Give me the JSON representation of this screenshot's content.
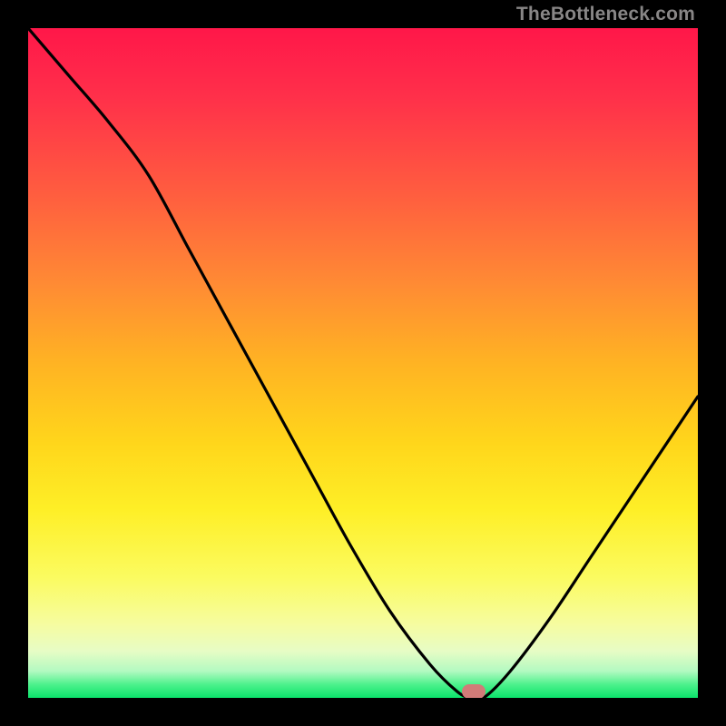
{
  "watermark": {
    "text": "TheBottleneck.com"
  },
  "marker": {
    "x_pct": 66.5,
    "y_pct": 99.0,
    "color": "#d17b78"
  },
  "chart_data": {
    "type": "line",
    "title": "",
    "xlabel": "",
    "ylabel": "",
    "xlim": [
      0,
      100
    ],
    "ylim": [
      0,
      100
    ],
    "grid": false,
    "legend": false,
    "background": "red-yellow-green vertical gradient",
    "series": [
      {
        "name": "bottleneck-curve",
        "x": [
          0,
          6,
          12,
          18,
          24,
          30,
          36,
          42,
          48,
          54,
          60,
          64,
          66,
          68,
          72,
          78,
          84,
          90,
          96,
          100
        ],
        "y": [
          100,
          93,
          86,
          78,
          67,
          56,
          45,
          34,
          23,
          13,
          5,
          1,
          0,
          0,
          4,
          12,
          21,
          30,
          39,
          45
        ]
      }
    ],
    "marker_point": {
      "x": 66.5,
      "y": 0
    },
    "notes": "y represents the visual height above bottom (0 = bottom green band, 100 = top red). Curve descends steeply from top-left, reaches minimum near x≈66, then rises toward the right edge."
  }
}
